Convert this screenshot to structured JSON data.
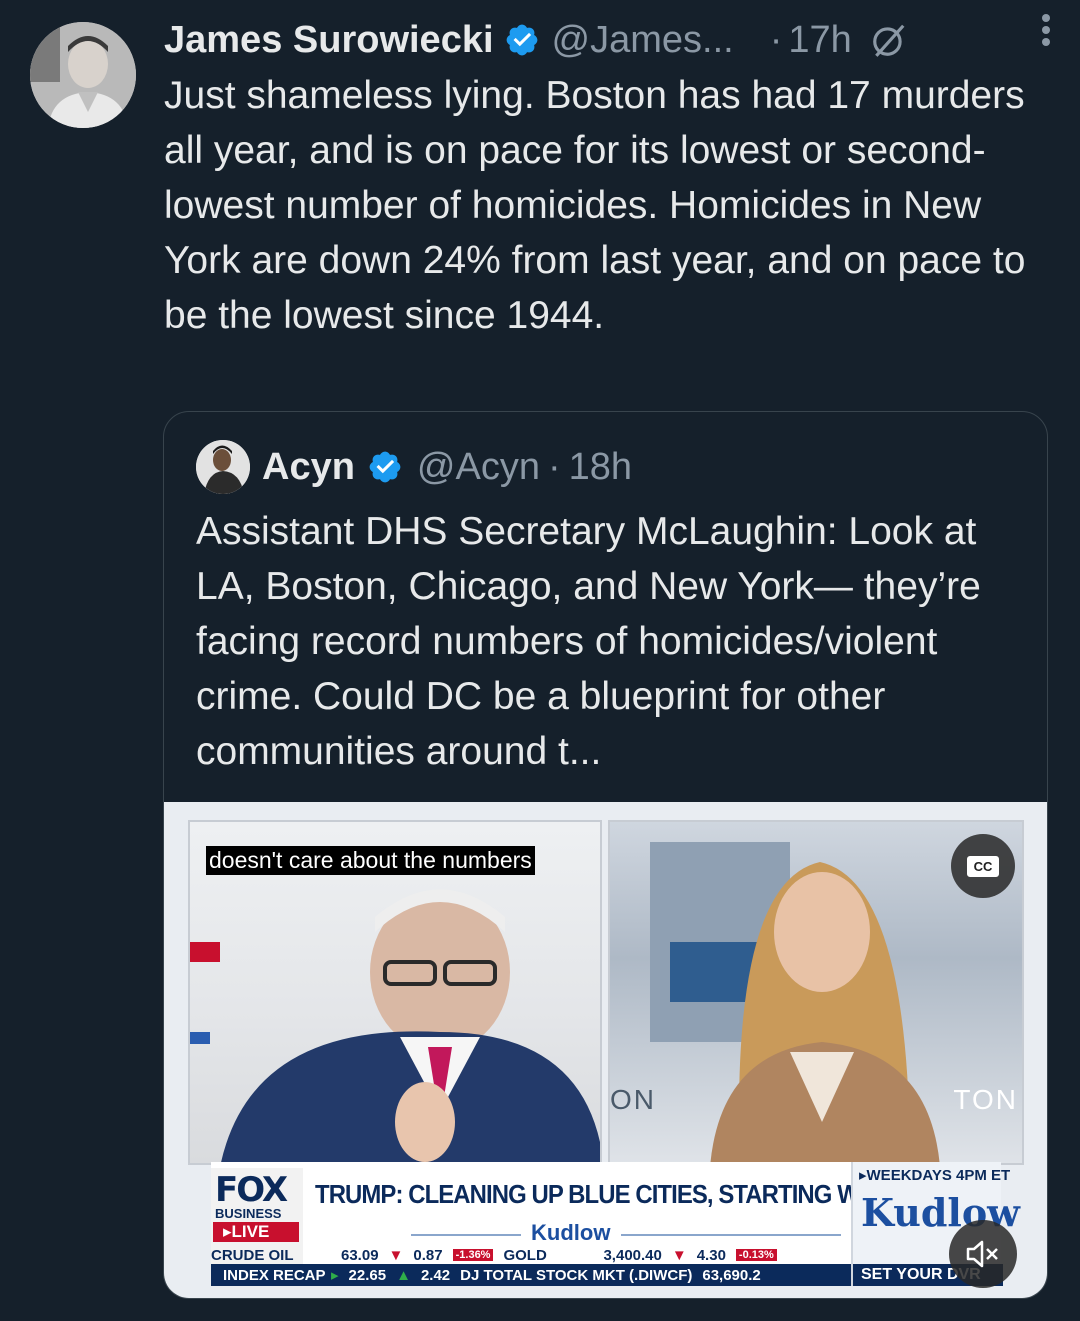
{
  "post": {
    "author_name": "James Surowiecki",
    "author_handle": "@James...",
    "separator": "·",
    "time": "17h",
    "text": "Just shameless lying. Boston has had 17 murders all year, and is on pace for its lowest or second-lowest number of homicides. Homicides in New York are down 24% from last year, and on pace to be the lowest since 1944."
  },
  "quote": {
    "author_name": "Acyn",
    "author_handle": "@Acyn",
    "separator": "·",
    "time": "18h",
    "text": "Assistant DHS Secretary McLaughin: Look at LA, Boston, Chicago, and New York— they’re facing record numbers of homicides/violent crime. Could DC be a blueprint for other communities around t..."
  },
  "video": {
    "caption": "doesn't care about the numbers",
    "cc_label": "CC",
    "wall_left": "ON",
    "wall_right": "TON",
    "ticker": {
      "network": "FOX",
      "network_sub": "BUSINESS",
      "live": "▸LIVE",
      "headline": "TRUMP: CLEANING UP BLUE CITIES, STARTING WITH DC",
      "show_mid": "Kudlow",
      "show_time": "▸WEEKDAYS 4PM ET",
      "show_name": "Kudlow",
      "dvr": "SET YOUR DVR",
      "row1": {
        "label1": "CRUDE OIL",
        "val1": "63.09",
        "chg1": "0.87",
        "pct1": "-1.36%",
        "label2": "GOLD",
        "val2": "3,400.40",
        "chg2": "4.30",
        "pct2": "-0.13%"
      },
      "row2": {
        "label1": "INDEX RECAP",
        "val1": "22.65",
        "chg1": "2.42",
        "label2": "DJ TOTAL STOCK MKT (.DIWCF)",
        "val2": "63,690.2"
      }
    }
  },
  "colors": {
    "background": "#15202b",
    "text": "#e7e9ea",
    "muted": "#8b98a5",
    "verified": "#1d9bf0",
    "border": "#38444d"
  }
}
